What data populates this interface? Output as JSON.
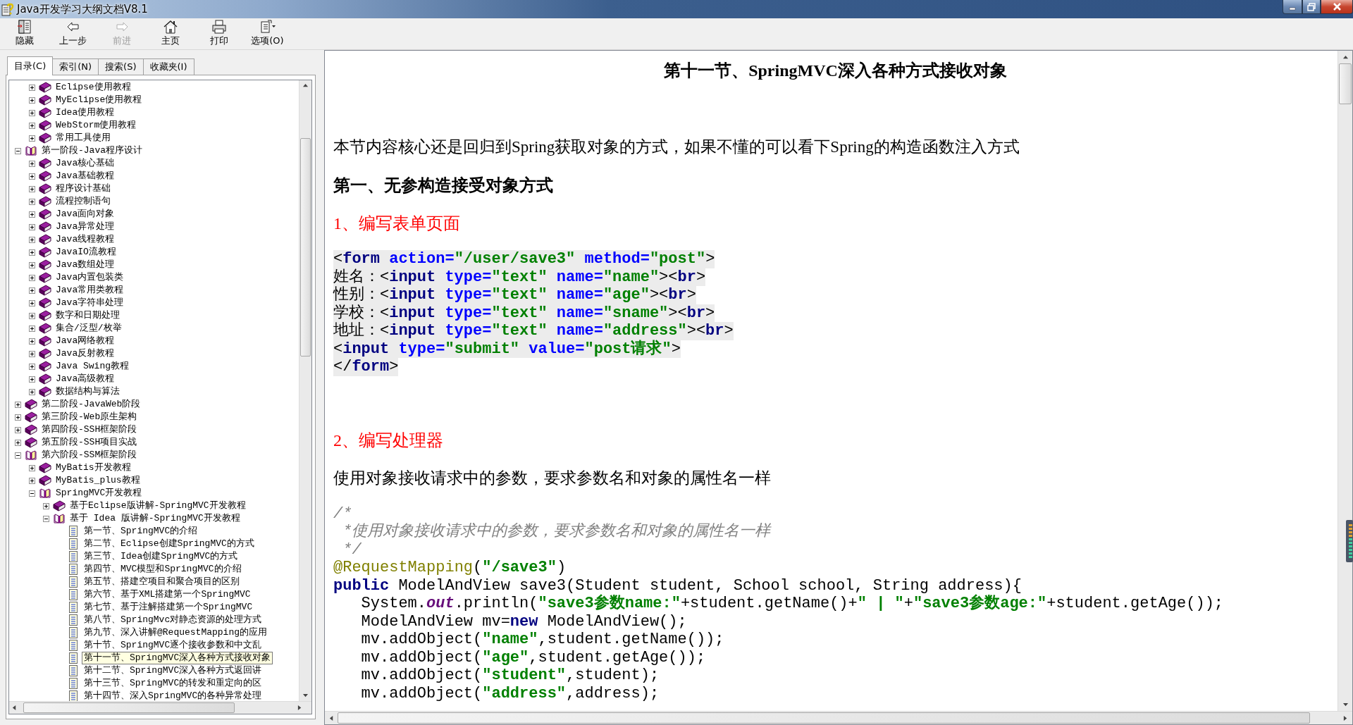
{
  "window": {
    "title": "Java开发学习大纲文档V8.1"
  },
  "toolbar": [
    {
      "kind": "hide",
      "label": "隐藏",
      "disabled": false
    },
    {
      "kind": "back",
      "label": "上一步",
      "disabled": false
    },
    {
      "kind": "forward",
      "label": "前进",
      "disabled": true
    },
    {
      "kind": "home",
      "label": "主页",
      "disabled": false
    },
    {
      "kind": "print",
      "label": "打印",
      "disabled": false
    },
    {
      "kind": "options",
      "label": "选项(O)",
      "disabled": false
    }
  ],
  "tabs": [
    {
      "label": "目录(C)",
      "selected": true
    },
    {
      "label": "索引(N)",
      "selected": false
    },
    {
      "label": "搜索(S)",
      "selected": false
    },
    {
      "label": "收藏夹(I)",
      "selected": false
    }
  ],
  "tree": {
    "scrolled_children": [
      {
        "kind": "folder",
        "label": "Eclipse使用教程",
        "expanded": false,
        "selected": false
      },
      {
        "kind": "folder",
        "label": "MyEclipse使用教程",
        "expanded": false,
        "selected": false
      },
      {
        "kind": "folder",
        "label": "Idea使用教程",
        "expanded": false,
        "selected": false
      },
      {
        "kind": "folder",
        "label": "WebStorm使用教程",
        "expanded": false,
        "selected": false
      },
      {
        "kind": "folder",
        "label": "常用工具使用",
        "expanded": false,
        "selected": false
      }
    ],
    "items": [
      {
        "kind": "folder",
        "label": "第一阶段-Java程序设计",
        "expanded": true,
        "selected": false,
        "children": [
          {
            "kind": "folder",
            "label": "Java核心基础",
            "expanded": false,
            "selected": false
          },
          {
            "kind": "folder",
            "label": "Java基础教程",
            "expanded": false,
            "selected": false
          },
          {
            "kind": "folder",
            "label": "程序设计基础",
            "expanded": false,
            "selected": false
          },
          {
            "kind": "folder",
            "label": "流程控制语句",
            "expanded": false,
            "selected": false
          },
          {
            "kind": "folder",
            "label": "Java面向对象",
            "expanded": false,
            "selected": false
          },
          {
            "kind": "folder",
            "label": "Java异常处理",
            "expanded": false,
            "selected": false
          },
          {
            "kind": "folder",
            "label": "Java线程教程",
            "expanded": false,
            "selected": false
          },
          {
            "kind": "folder",
            "label": "JavaIO流教程",
            "expanded": false,
            "selected": false
          },
          {
            "kind": "folder",
            "label": "Java数组处理",
            "expanded": false,
            "selected": false
          },
          {
            "kind": "folder",
            "label": "Java内置包装类",
            "expanded": false,
            "selected": false
          },
          {
            "kind": "folder",
            "label": "Java常用类教程",
            "expanded": false,
            "selected": false
          },
          {
            "kind": "folder",
            "label": "Java字符串处理",
            "expanded": false,
            "selected": false
          },
          {
            "kind": "folder",
            "label": "数字和日期处理",
            "expanded": false,
            "selected": false
          },
          {
            "kind": "folder",
            "label": "集合/泛型/枚举",
            "expanded": false,
            "selected": false
          },
          {
            "kind": "folder",
            "label": "Java网络教程",
            "expanded": false,
            "selected": false
          },
          {
            "kind": "folder",
            "label": "Java反射教程",
            "expanded": false,
            "selected": false
          },
          {
            "kind": "folder",
            "label": "Java Swing教程",
            "expanded": false,
            "selected": false
          },
          {
            "kind": "folder",
            "label": "Java高级教程",
            "expanded": false,
            "selected": false
          },
          {
            "kind": "folder",
            "label": "数据结构与算法",
            "expanded": false,
            "selected": false
          }
        ]
      },
      {
        "kind": "folder",
        "label": "第二阶段-JavaWeb阶段",
        "expanded": false,
        "selected": false
      },
      {
        "kind": "folder",
        "label": "第三阶段-Web原生架构",
        "expanded": false,
        "selected": false
      },
      {
        "kind": "folder",
        "label": "第四阶段-SSH框架阶段",
        "expanded": false,
        "selected": false
      },
      {
        "kind": "folder",
        "label": "第五阶段-SSH项目实战",
        "expanded": false,
        "selected": false
      },
      {
        "kind": "folder",
        "label": "第六阶段-SSM框架阶段",
        "expanded": true,
        "selected": false,
        "children": [
          {
            "kind": "folder",
            "label": "MyBatis开发教程",
            "expanded": false,
            "selected": false
          },
          {
            "kind": "folder",
            "label": "MyBatis_plus教程",
            "expanded": false,
            "selected": false
          },
          {
            "kind": "folder",
            "label": "SpringMVC开发教程",
            "expanded": true,
            "selected": false,
            "children": [
              {
                "kind": "folder",
                "label": "基于Eclipse版讲解-SpringMVC开发教程",
                "expanded": false,
                "selected": false
              },
              {
                "kind": "folder",
                "label": "基于 Idea 版讲解-SpringMVC开发教程",
                "expanded": true,
                "selected": false,
                "children": [
                  {
                    "kind": "page",
                    "label": "第一节、SpringMVC的介绍",
                    "selected": false
                  },
                  {
                    "kind": "page",
                    "label": "第二节、Eclipse创建SpringMVC的方式",
                    "selected": false
                  },
                  {
                    "kind": "page",
                    "label": "第三节、Idea创建SpringMVC的方式",
                    "selected": false
                  },
                  {
                    "kind": "page",
                    "label": "第四节、MVC模型和SpringMVC的介绍",
                    "selected": false
                  },
                  {
                    "kind": "page",
                    "label": "第五节、搭建空项目和聚合项目的区别",
                    "selected": false
                  },
                  {
                    "kind": "page",
                    "label": "第六节、基于XML搭建第一个SpringMVC",
                    "selected": false
                  },
                  {
                    "kind": "page",
                    "label": "第七节、基于注解搭建第一个SpringMVC",
                    "selected": false
                  },
                  {
                    "kind": "page",
                    "label": "第八节、SpringMvc对静态资源的处理方式",
                    "selected": false
                  },
                  {
                    "kind": "page",
                    "label": "第九节、深入讲解@RequestMapping的应用",
                    "selected": false
                  },
                  {
                    "kind": "page",
                    "label": "第十节、SpringMVC逐个接收参数和中文乱",
                    "selected": false
                  },
                  {
                    "kind": "page",
                    "label": "第十一节、SpringMVC深入各种方式接收对象",
                    "selected": true
                  },
                  {
                    "kind": "page",
                    "label": "第十二节、SpringMVC深入各种方式返回讲",
                    "selected": false
                  },
                  {
                    "kind": "page",
                    "label": "第十三节、SpringMVC的转发和重定向的区",
                    "selected": false
                  },
                  {
                    "kind": "page",
                    "label": "第十四节、深入SpringMVC的各种异常处理",
                    "selected": false
                  }
                ]
              }
            ]
          }
        ]
      }
    ]
  },
  "article": {
    "title": "第十一节、SpringMVC深入各种方式接收对象",
    "blocks": [
      {
        "kind": "paragraph",
        "text": "本节内容核心还是回归到Spring获取对象的方式，如果不懂的可以看下Spring的构造函数注入方式"
      },
      {
        "kind": "heading",
        "text": "第一、无参构造接受对象方式"
      },
      {
        "kind": "subheading",
        "text": "1、编写表单页面"
      },
      {
        "kind": "code",
        "shaded": true,
        "lines": [
          [
            {
              "kind": "plain",
              "text": "<"
            },
            {
              "kind": "tag",
              "text": "form"
            },
            {
              "kind": "attr",
              "text": " action="
            },
            {
              "kind": "string",
              "text": "\"/user/save3\""
            },
            {
              "kind": "attr",
              "text": " method="
            },
            {
              "kind": "string",
              "text": "\"post\""
            },
            {
              "kind": "plain",
              "text": ">"
            }
          ],
          [
            {
              "kind": "plain",
              "text": "姓名：<"
            },
            {
              "kind": "tag",
              "text": "input"
            },
            {
              "kind": "attr",
              "text": " type="
            },
            {
              "kind": "string",
              "text": "\"text\""
            },
            {
              "kind": "attr",
              "text": " name="
            },
            {
              "kind": "string",
              "text": "\"name\""
            },
            {
              "kind": "plain",
              "text": "><"
            },
            {
              "kind": "tag",
              "text": "br"
            },
            {
              "kind": "plain",
              "text": ">"
            }
          ],
          [
            {
              "kind": "plain",
              "text": "性别：<"
            },
            {
              "kind": "tag",
              "text": "input"
            },
            {
              "kind": "attr",
              "text": " type="
            },
            {
              "kind": "string",
              "text": "\"text\""
            },
            {
              "kind": "attr",
              "text": " name="
            },
            {
              "kind": "string",
              "text": "\"age\""
            },
            {
              "kind": "plain",
              "text": "><"
            },
            {
              "kind": "tag",
              "text": "br"
            },
            {
              "kind": "plain",
              "text": ">"
            }
          ],
          [
            {
              "kind": "plain",
              "text": "学校：<"
            },
            {
              "kind": "tag",
              "text": "input"
            },
            {
              "kind": "attr",
              "text": " type="
            },
            {
              "kind": "string",
              "text": "\"text\""
            },
            {
              "kind": "attr",
              "text": " name="
            },
            {
              "kind": "string",
              "text": "\"sname\""
            },
            {
              "kind": "plain",
              "text": "><"
            },
            {
              "kind": "tag",
              "text": "br"
            },
            {
              "kind": "plain",
              "text": ">"
            }
          ],
          [
            {
              "kind": "plain",
              "text": "地址：<"
            },
            {
              "kind": "tag",
              "text": "input"
            },
            {
              "kind": "attr",
              "text": " type="
            },
            {
              "kind": "string",
              "text": "\"text\""
            },
            {
              "kind": "attr",
              "text": " name="
            },
            {
              "kind": "string",
              "text": "\"address\""
            },
            {
              "kind": "plain",
              "text": "><"
            },
            {
              "kind": "tag",
              "text": "br"
            },
            {
              "kind": "plain",
              "text": ">"
            }
          ],
          [
            {
              "kind": "plain",
              "text": "<"
            },
            {
              "kind": "tag",
              "text": "input"
            },
            {
              "kind": "attr",
              "text": " type="
            },
            {
              "kind": "string",
              "text": "\"submit\""
            },
            {
              "kind": "attr",
              "text": " value="
            },
            {
              "kind": "string",
              "text": "\"post请求\""
            },
            {
              "kind": "plain",
              "text": ">"
            }
          ],
          [
            {
              "kind": "plain",
              "text": "</"
            },
            {
              "kind": "tag",
              "text": "form"
            },
            {
              "kind": "plain",
              "text": ">"
            }
          ]
        ]
      },
      {
        "kind": "subheading",
        "text": "2、编写处理器"
      },
      {
        "kind": "paragraph",
        "text": "使用对象接收请求中的参数，要求参数名和对象的属性名一样"
      },
      {
        "kind": "code",
        "shaded": false,
        "lines": [
          [
            {
              "kind": "comment",
              "text": "/*"
            }
          ],
          [
            {
              "kind": "comment",
              "text": " *使用对象接收请求中的参数，要求参数名和对象的属性名一样"
            }
          ],
          [
            {
              "kind": "comment",
              "text": " */"
            }
          ],
          [
            {
              "kind": "annotation",
              "text": "@RequestMapping"
            },
            {
              "kind": "plain",
              "text": "("
            },
            {
              "kind": "string",
              "text": "\"/save3\""
            },
            {
              "kind": "plain",
              "text": ")"
            }
          ],
          [
            {
              "kind": "keyword",
              "text": "public"
            },
            {
              "kind": "plain",
              "text": " ModelAndView save3(Student student, School school, String address){"
            }
          ],
          [
            {
              "kind": "plain",
              "text": "   System."
            },
            {
              "kind": "field",
              "text": "out"
            },
            {
              "kind": "plain",
              "text": ".println("
            },
            {
              "kind": "string",
              "text": "\"save3参数name:\""
            },
            {
              "kind": "plain",
              "text": "+student.getName()+"
            },
            {
              "kind": "string",
              "text": "\" | \""
            },
            {
              "kind": "plain",
              "text": "+"
            },
            {
              "kind": "string",
              "text": "\"save3参数age:\""
            },
            {
              "kind": "plain",
              "text": "+student.getAge());"
            }
          ],
          [
            {
              "kind": "plain",
              "text": "   ModelAndView mv="
            },
            {
              "kind": "keyword",
              "text": "new"
            },
            {
              "kind": "plain",
              "text": " ModelAndView();"
            }
          ],
          [
            {
              "kind": "plain",
              "text": "   mv.addObject("
            },
            {
              "kind": "string",
              "text": "\"name\""
            },
            {
              "kind": "plain",
              "text": ",student.getName());"
            }
          ],
          [
            {
              "kind": "plain",
              "text": "   mv.addObject("
            },
            {
              "kind": "string",
              "text": "\"age\""
            },
            {
              "kind": "plain",
              "text": ",student.getAge());"
            }
          ],
          [
            {
              "kind": "plain",
              "text": "   mv.addObject("
            },
            {
              "kind": "string",
              "text": "\"student\""
            },
            {
              "kind": "plain",
              "text": ",student);"
            }
          ],
          [
            {
              "kind": "plain",
              "text": "   mv.addObject("
            },
            {
              "kind": "string",
              "text": "\"address\""
            },
            {
              "kind": "plain",
              "text": ",address);"
            }
          ]
        ]
      }
    ]
  }
}
